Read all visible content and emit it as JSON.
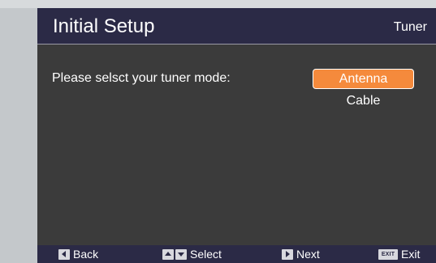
{
  "header": {
    "title": "Initial Setup",
    "section": "Tuner"
  },
  "main": {
    "prompt": "Please selsct your tuner mode:",
    "options": [
      {
        "label": "Antenna",
        "selected": true
      },
      {
        "label": "Cable",
        "selected": false
      }
    ]
  },
  "footer": {
    "back_label": "Back",
    "select_label": "Select",
    "next_label": "Next",
    "exit_key": "EXIT",
    "exit_label": "Exit"
  },
  "colors": {
    "header_bg": "#2b2a46",
    "body_bg": "#3b3b3b",
    "highlight": "#f58a3c"
  },
  "icons": [
    "left-arrow-key-icon",
    "up-arrow-key-icon",
    "down-arrow-key-icon",
    "right-arrow-key-icon",
    "exit-key-icon"
  ]
}
